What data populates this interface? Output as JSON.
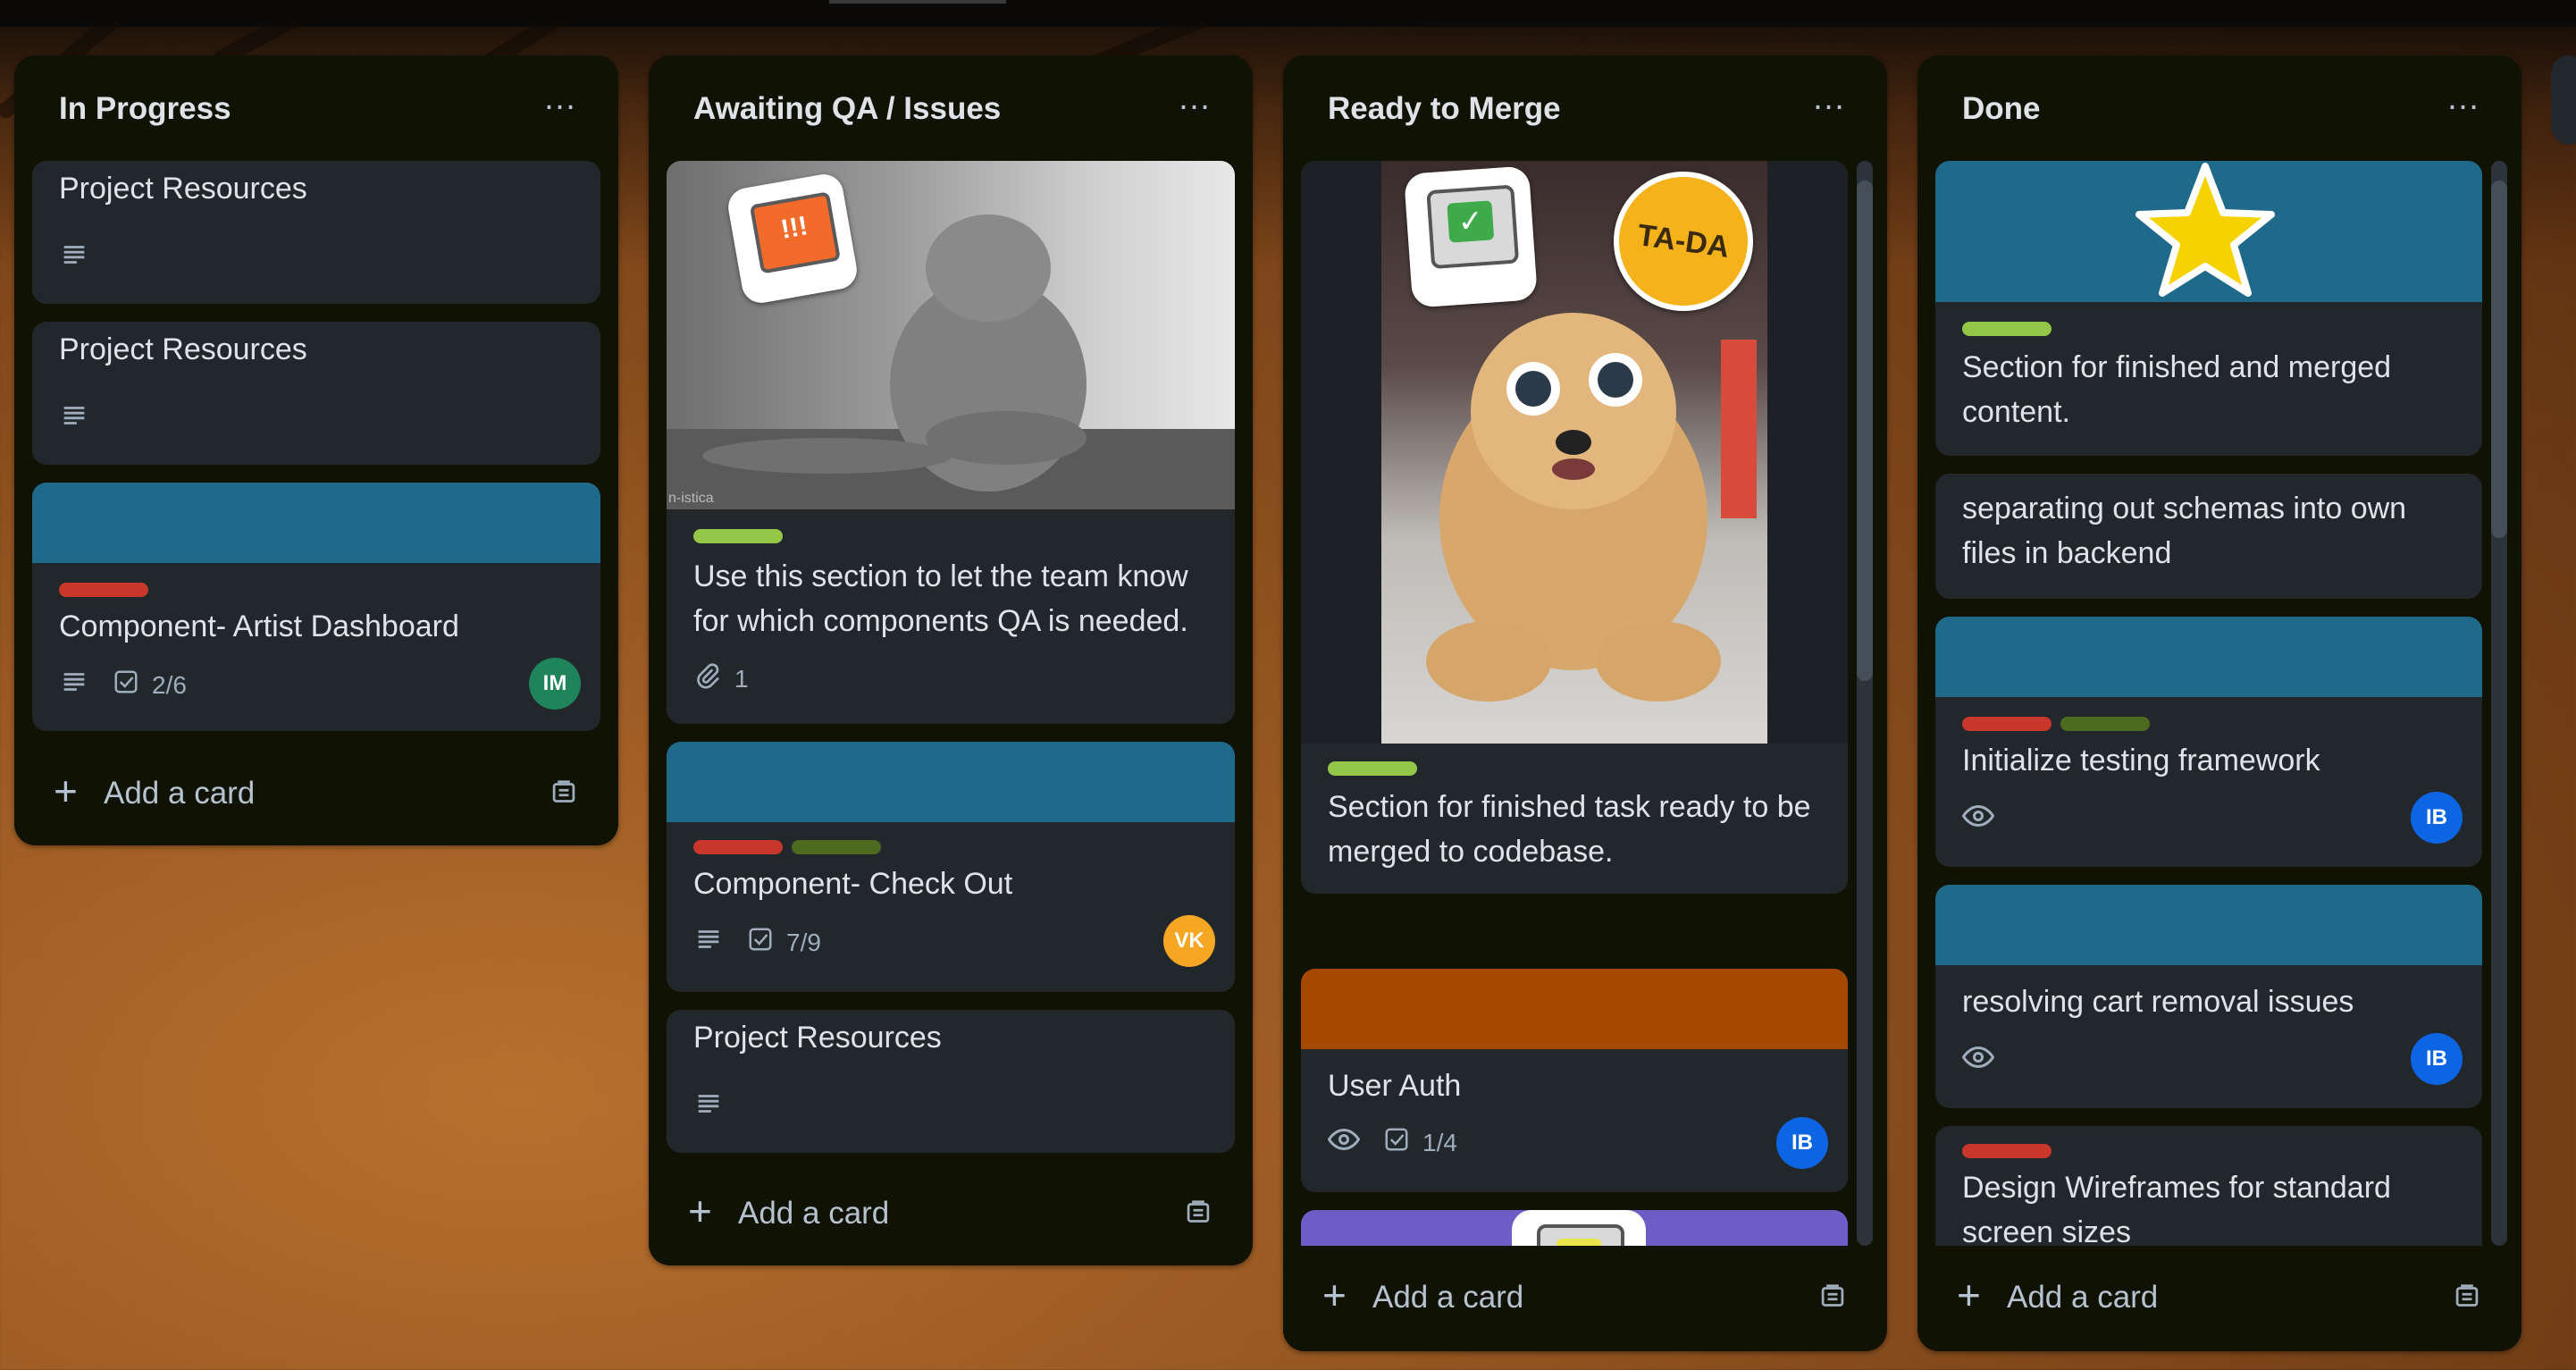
{
  "colors": {
    "list_bg": "#101204",
    "card_bg": "#22272b",
    "cover_teal": "#1f6a8a",
    "cover_orange": "#a54800",
    "cover_purple": "#6e5dc6",
    "label_red": "#c9372c",
    "label_green": "#4c6b1f",
    "label_lime": "#94c748",
    "avatar_green": "#1f845a",
    "avatar_orange": "#f5a623",
    "avatar_blue": "#0c66e4"
  },
  "board": {
    "add_card_label": "Add a card",
    "lists": [
      {
        "title": "In Progress",
        "menu": "…",
        "cards": [
          {
            "title": "Project Resources",
            "icons": [
              "description-icon"
            ]
          },
          {
            "title": "Project Resources",
            "icons": [
              "description-icon"
            ]
          },
          {
            "title": "Component- Artist Dashboard",
            "cover": "teal",
            "labels": [
              "red"
            ],
            "checklist": "2/6",
            "avatar": "IM"
          }
        ]
      },
      {
        "title": "Awaiting QA / Issues",
        "menu": "…",
        "cards": [
          {
            "cover_image": "cat-photo-with-alert-sticker",
            "watermark": "n-istica",
            "labels": [
              "lime"
            ],
            "title": "Use this section to let the team know for which components QA is needed.",
            "attachments": "1"
          },
          {
            "title": "Component- Check Out",
            "cover": "teal",
            "labels": [
              "red",
              "green"
            ],
            "checklist": "7/9",
            "avatar": "VK"
          },
          {
            "title": "Project Resources",
            "icons": [
              "description-icon"
            ]
          }
        ]
      },
      {
        "title": "Ready to Merge",
        "menu": "…",
        "cards": [
          {
            "cover_image": "dog-with-sunglasses-and-tada-sticker",
            "sticker_text": "TA-DA",
            "labels": [
              "lime"
            ],
            "title": "Section for finished task ready to be merged to codebase."
          },
          {
            "title": "User Auth",
            "cover": "orange",
            "checklist": "1/4",
            "avatar": "IB"
          },
          {
            "cover": "purple",
            "cover_image": "computer-sticker"
          }
        ]
      },
      {
        "title": "Done",
        "menu": "…",
        "cards": [
          {
            "cover": "teal",
            "cover_image": "star-sticker",
            "labels": [
              "lime"
            ],
            "title": "Section for finished and merged content."
          },
          {
            "title": "separating out schemas into own files in backend"
          },
          {
            "title": "Initialize testing framework",
            "cover": "teal",
            "labels": [
              "red",
              "green"
            ],
            "avatar": "IB"
          },
          {
            "title": "resolving cart removal issues",
            "cover": "teal",
            "avatar": "IB"
          },
          {
            "title": "Design Wireframes for standard screen sizes",
            "labels": [
              "red"
            ]
          }
        ]
      }
    ]
  }
}
